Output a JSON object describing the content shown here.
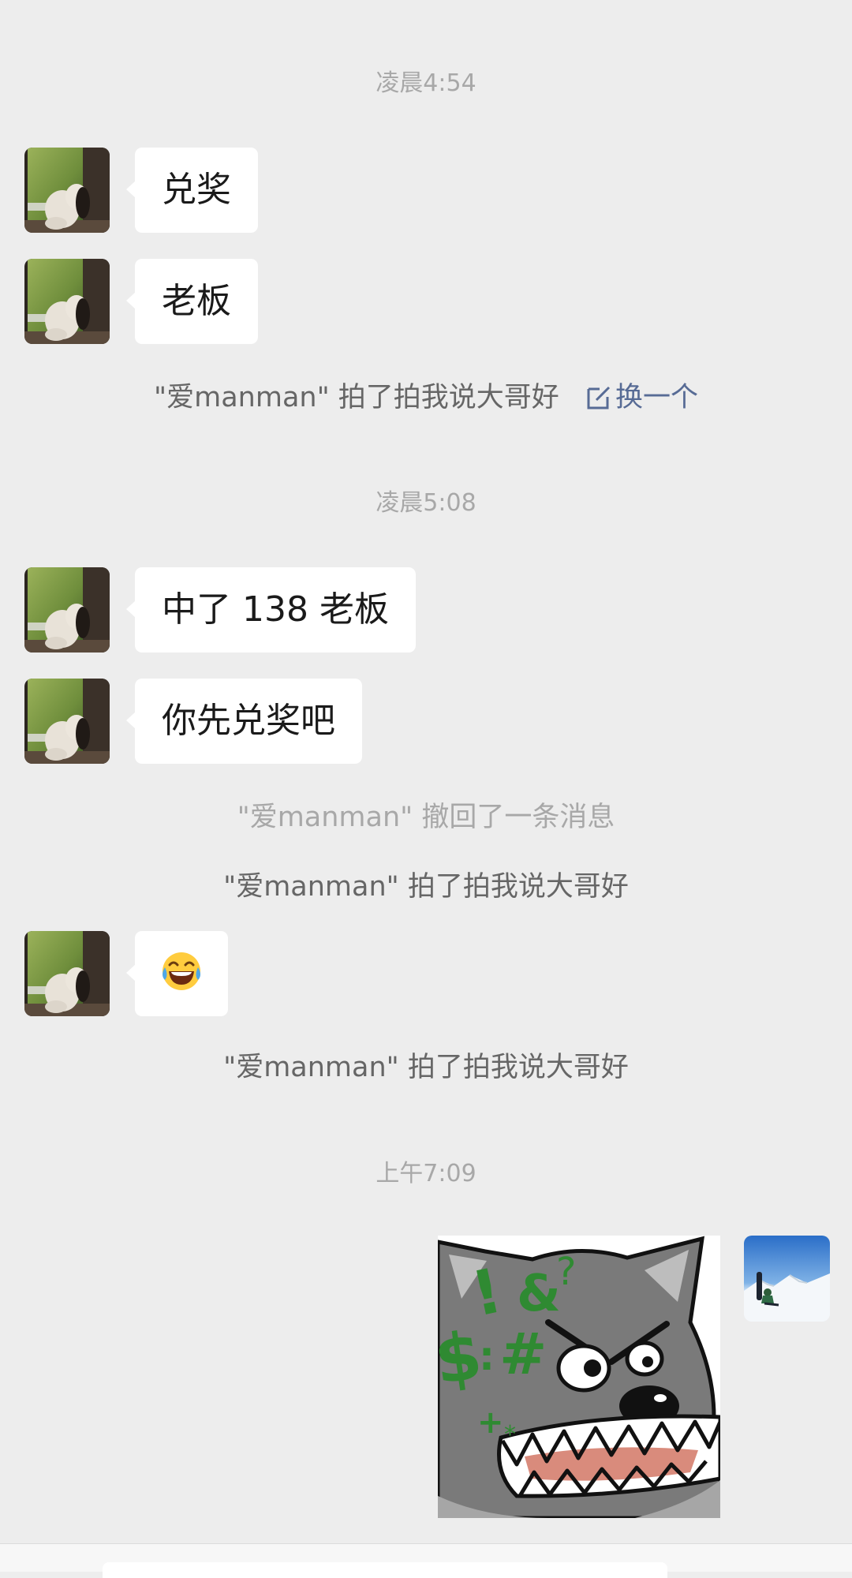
{
  "timestamps": [
    "凌晨4:54",
    "凌晨5:08",
    "上午7:09"
  ],
  "messages": [
    {
      "sender": "other",
      "text": "兑奖"
    },
    {
      "sender": "other",
      "text": "老板"
    },
    {
      "sender": "other",
      "text": "中了 138 老板"
    },
    {
      "sender": "other",
      "text": "你先兑奖吧"
    },
    {
      "sender": "other",
      "text": "😂"
    }
  ],
  "system": {
    "pat_1": "\"爱manman\" 拍了拍我说大哥好",
    "pat_1_action": "换一个",
    "recall": "\"爱manman\" 撤回了一条消息",
    "pat_2": "\"爱manman\" 拍了拍我说大哥好",
    "pat_3": "\"爱manman\" 拍了拍我说大哥好"
  },
  "sticker": {
    "sender": "me",
    "text": "!&?$:#"
  },
  "colors": {
    "background": "#ededed",
    "bubble_other": "#ffffff",
    "link": "#576b95",
    "timestamp": "#a8a8a8"
  }
}
